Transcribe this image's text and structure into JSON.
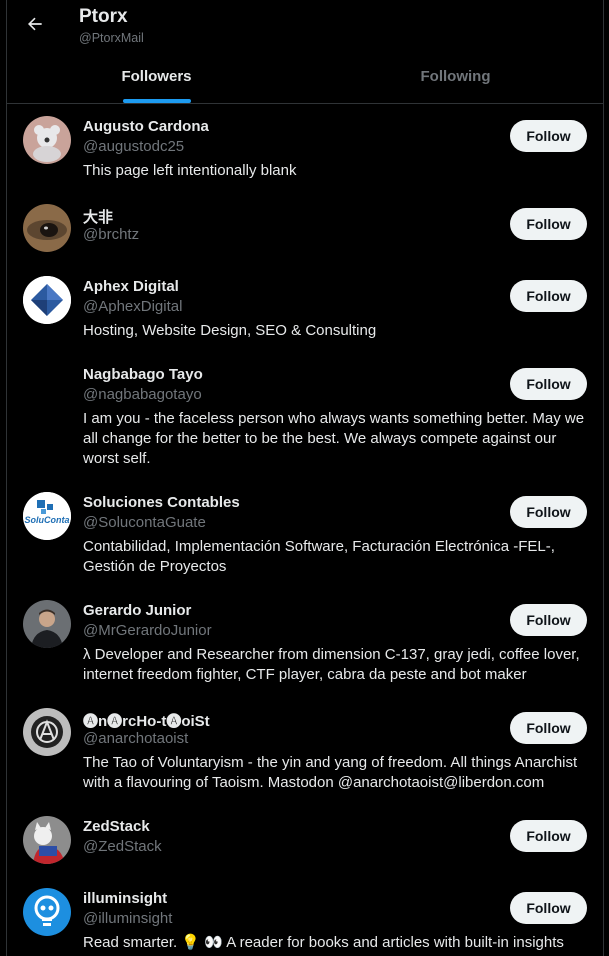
{
  "header": {
    "title": "Ptorx",
    "handle": "@PtorxMail"
  },
  "tabs": [
    {
      "label": "Followers",
      "active": true
    },
    {
      "label": "Following",
      "active": false
    }
  ],
  "colors": {
    "background": "#000000",
    "accent": "#1d9bf0",
    "text_primary": "#e7e9ea",
    "text_secondary": "#71767b",
    "follow_button_bg": "#eff3f4"
  },
  "users": [
    {
      "name": "Augusto Cardona",
      "handle": "@augustodc25",
      "bio": "This page left intentionally blank",
      "follow_label": "Follow",
      "avatar": "koala-photo"
    },
    {
      "name": "大非",
      "handle": "@brchtz",
      "bio": "",
      "follow_label": "Follow",
      "avatar": "eye-closeup-photo"
    },
    {
      "name": "Aphex Digital",
      "handle": "@AphexDigital",
      "bio": "Hosting, Website Design, SEO & Consulting",
      "follow_label": "Follow",
      "avatar": "blue-diamond-logo"
    },
    {
      "name": "Nagbabago Tayo",
      "handle": "@nagbabagotayo",
      "bio": "I am you - the faceless person who always wants something better. May we all change for the better to be the best. We always compete against our worst self.",
      "follow_label": "Follow",
      "avatar": "blank"
    },
    {
      "name": "Soluciones Contables",
      "handle": "@SolucontaGuate",
      "bio": "Contabilidad, Implementación Software, Facturación Electrónica -FEL-, Gestión de Proyectos",
      "follow_label": "Follow",
      "avatar": "soluconta-logo"
    },
    {
      "name": "Gerardo Junior",
      "handle": "@MrGerardoJunior",
      "bio": "λ Developer and Researcher from dimension C-137, gray jedi, coffee lover, internet freedom fighter, CTF player, cabra da peste and bot maker",
      "follow_label": "Follow",
      "avatar": "person-photo"
    },
    {
      "name": "🅐n🅐rcHo-t🅐oiSt",
      "handle": "@anarchotaoist",
      "bio": "The Tao of Voluntaryism - the yin and yang of freedom. All things Anarchist with a flavouring of Taoism. Mastodon @anarchotaoist@liberdon.com",
      "follow_label": "Follow",
      "avatar": "anarchy-symbol"
    },
    {
      "name": "ZedStack",
      "handle": "@ZedStack",
      "bio": "",
      "follow_label": "Follow",
      "avatar": "cat-photo"
    },
    {
      "name": "illuminsight",
      "handle": "@illuminsight",
      "bio": "Read smarter. 💡 👀 A reader for books and articles with built-in insights",
      "follow_label": "Follow",
      "avatar": "lightbulb-logo"
    }
  ]
}
